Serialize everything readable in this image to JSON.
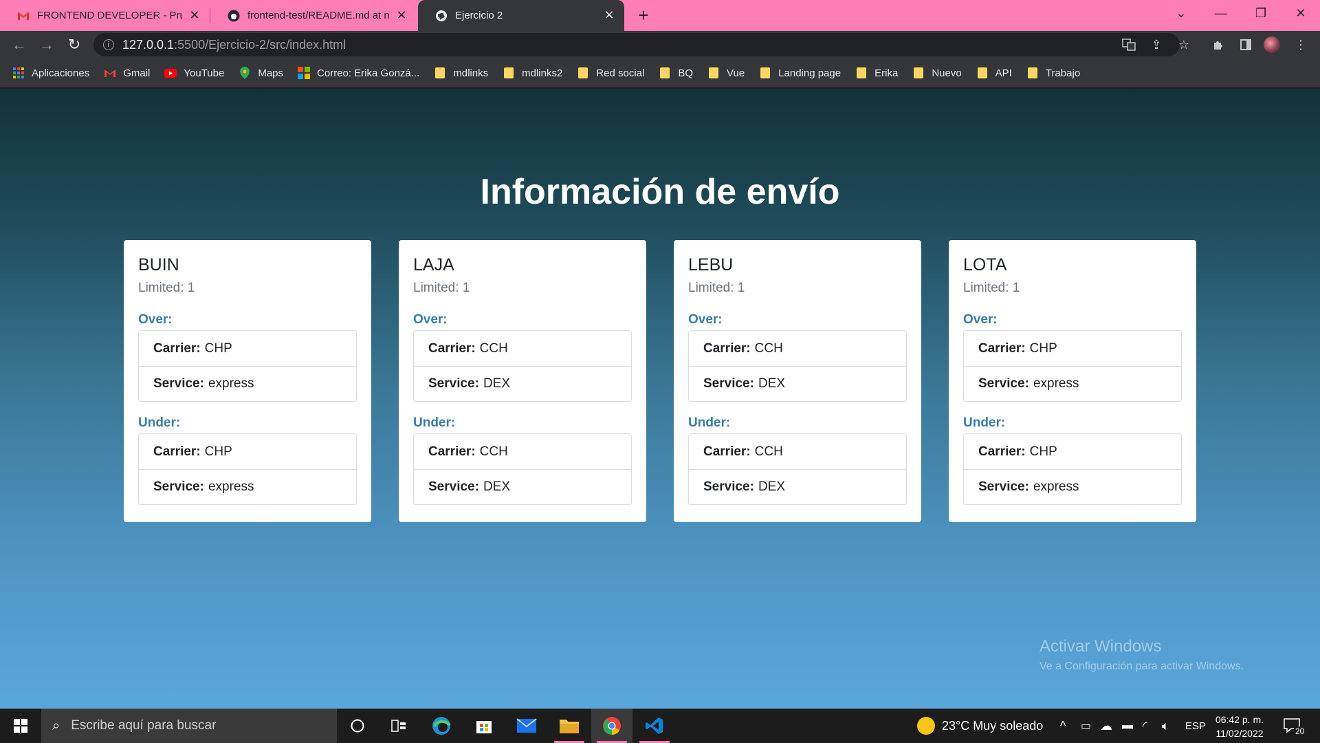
{
  "browser": {
    "tabs": [
      {
        "title": "FRONTEND DEVELOPER - Prueba",
        "icon": "gmail-icon",
        "active": false
      },
      {
        "title": "frontend-test/README.md at ma",
        "icon": "github-icon",
        "active": false
      },
      {
        "title": "Ejercicio 2",
        "icon": "globe-icon",
        "active": true
      }
    ],
    "url_host": "127.0.0.1",
    "url_path": ":5500/Ejercicio-2/src/index.html",
    "bookmarks": [
      {
        "label": "Aplicaciones",
        "icon": "apps-grid-icon"
      },
      {
        "label": "Gmail",
        "icon": "gmail-icon"
      },
      {
        "label": "YouTube",
        "icon": "youtube-icon"
      },
      {
        "label": "Maps",
        "icon": "maps-icon"
      },
      {
        "label": "Correo: Erika Gonzá...",
        "icon": "outlook-icon"
      },
      {
        "label": "mdlinks",
        "icon": "folder-icon"
      },
      {
        "label": "mdlinks2",
        "icon": "folder-icon"
      },
      {
        "label": "Red social",
        "icon": "folder-icon"
      },
      {
        "label": "BQ",
        "icon": "folder-icon"
      },
      {
        "label": "Vue",
        "icon": "folder-icon"
      },
      {
        "label": "Landing page",
        "icon": "folder-icon"
      },
      {
        "label": "Erika",
        "icon": "folder-icon"
      },
      {
        "label": "Nuevo",
        "icon": "folder-icon"
      },
      {
        "label": "API",
        "icon": "folder-icon"
      },
      {
        "label": "Trabajo",
        "icon": "folder-icon"
      }
    ]
  },
  "page": {
    "title": "Información de envío",
    "cards": [
      {
        "name": "BUIN",
        "limited": "Limited: 1",
        "over_label": "Over:",
        "over": {
          "carrier_key": "Carrier:",
          "carrier": "CHP",
          "service_key": "Service:",
          "service": "express"
        },
        "under_label": "Under:",
        "under": {
          "carrier_key": "Carrier:",
          "carrier": "CHP",
          "service_key": "Service:",
          "service": "express"
        }
      },
      {
        "name": "LAJA",
        "limited": "Limited: 1",
        "over_label": "Over:",
        "over": {
          "carrier_key": "Carrier:",
          "carrier": "CCH",
          "service_key": "Service:",
          "service": "DEX"
        },
        "under_label": "Under:",
        "under": {
          "carrier_key": "Carrier:",
          "carrier": "CCH",
          "service_key": "Service:",
          "service": "DEX"
        }
      },
      {
        "name": "LEBU",
        "limited": "Limited: 1",
        "over_label": "Over:",
        "over": {
          "carrier_key": "Carrier:",
          "carrier": "CCH",
          "service_key": "Service:",
          "service": "DEX"
        },
        "under_label": "Under:",
        "under": {
          "carrier_key": "Carrier:",
          "carrier": "CCH",
          "service_key": "Service:",
          "service": "DEX"
        }
      },
      {
        "name": "LOTA",
        "limited": "Limited: 1",
        "over_label": "Over:",
        "over": {
          "carrier_key": "Carrier:",
          "carrier": "CHP",
          "service_key": "Service:",
          "service": "express"
        },
        "under_label": "Under:",
        "under": {
          "carrier_key": "Carrier:",
          "carrier": "CHP",
          "service_key": "Service:",
          "service": "express"
        }
      }
    ],
    "watermark_title": "Activar Windows",
    "watermark_subtitle": "Ve a Configuración para activar Windows."
  },
  "taskbar": {
    "search_placeholder": "Escribe aquí para buscar",
    "weather": "23°C  Muy soleado",
    "language": "ESP",
    "time": "06:42 p. m.",
    "date": "11/02/2022",
    "notifications": "20"
  },
  "colors": {
    "tabstrip": "#ff7eb6",
    "section_label": "#3a7ca5",
    "page_gradient_top": "#123238",
    "page_gradient_bottom": "#5aa6dc"
  }
}
